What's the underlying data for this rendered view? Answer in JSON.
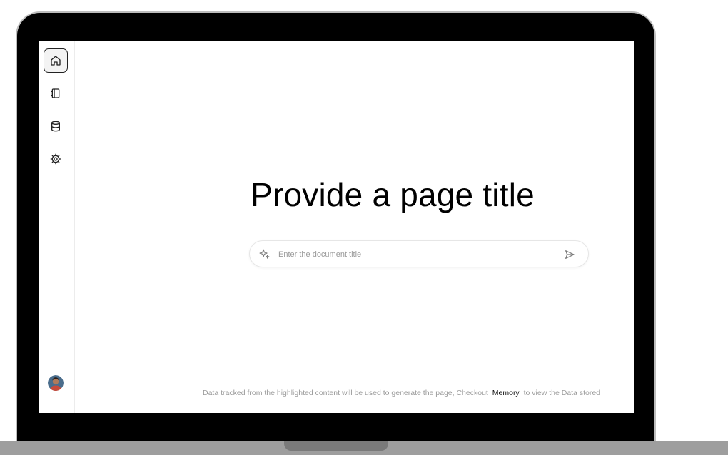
{
  "sidebar": {
    "items": [
      {
        "icon": "home-icon",
        "active": true
      },
      {
        "icon": "notebook-icon",
        "active": false
      },
      {
        "icon": "database-icon",
        "active": false
      },
      {
        "icon": "gear-icon",
        "active": false
      }
    ],
    "avatar": "user-avatar"
  },
  "main": {
    "title": "Provide a page title",
    "input": {
      "placeholder": "Enter the document title",
      "value": ""
    }
  },
  "footer": {
    "text_before": "Data tracked from the highlighted content will be used to generate the page, Checkout",
    "link_label": "Memory",
    "text_after": "to view the Data stored"
  },
  "colors": {
    "bezel": "#000000",
    "screen_bg": "#ffffff",
    "muted_text": "#9a9a9a",
    "base": "#9e9e9e"
  }
}
